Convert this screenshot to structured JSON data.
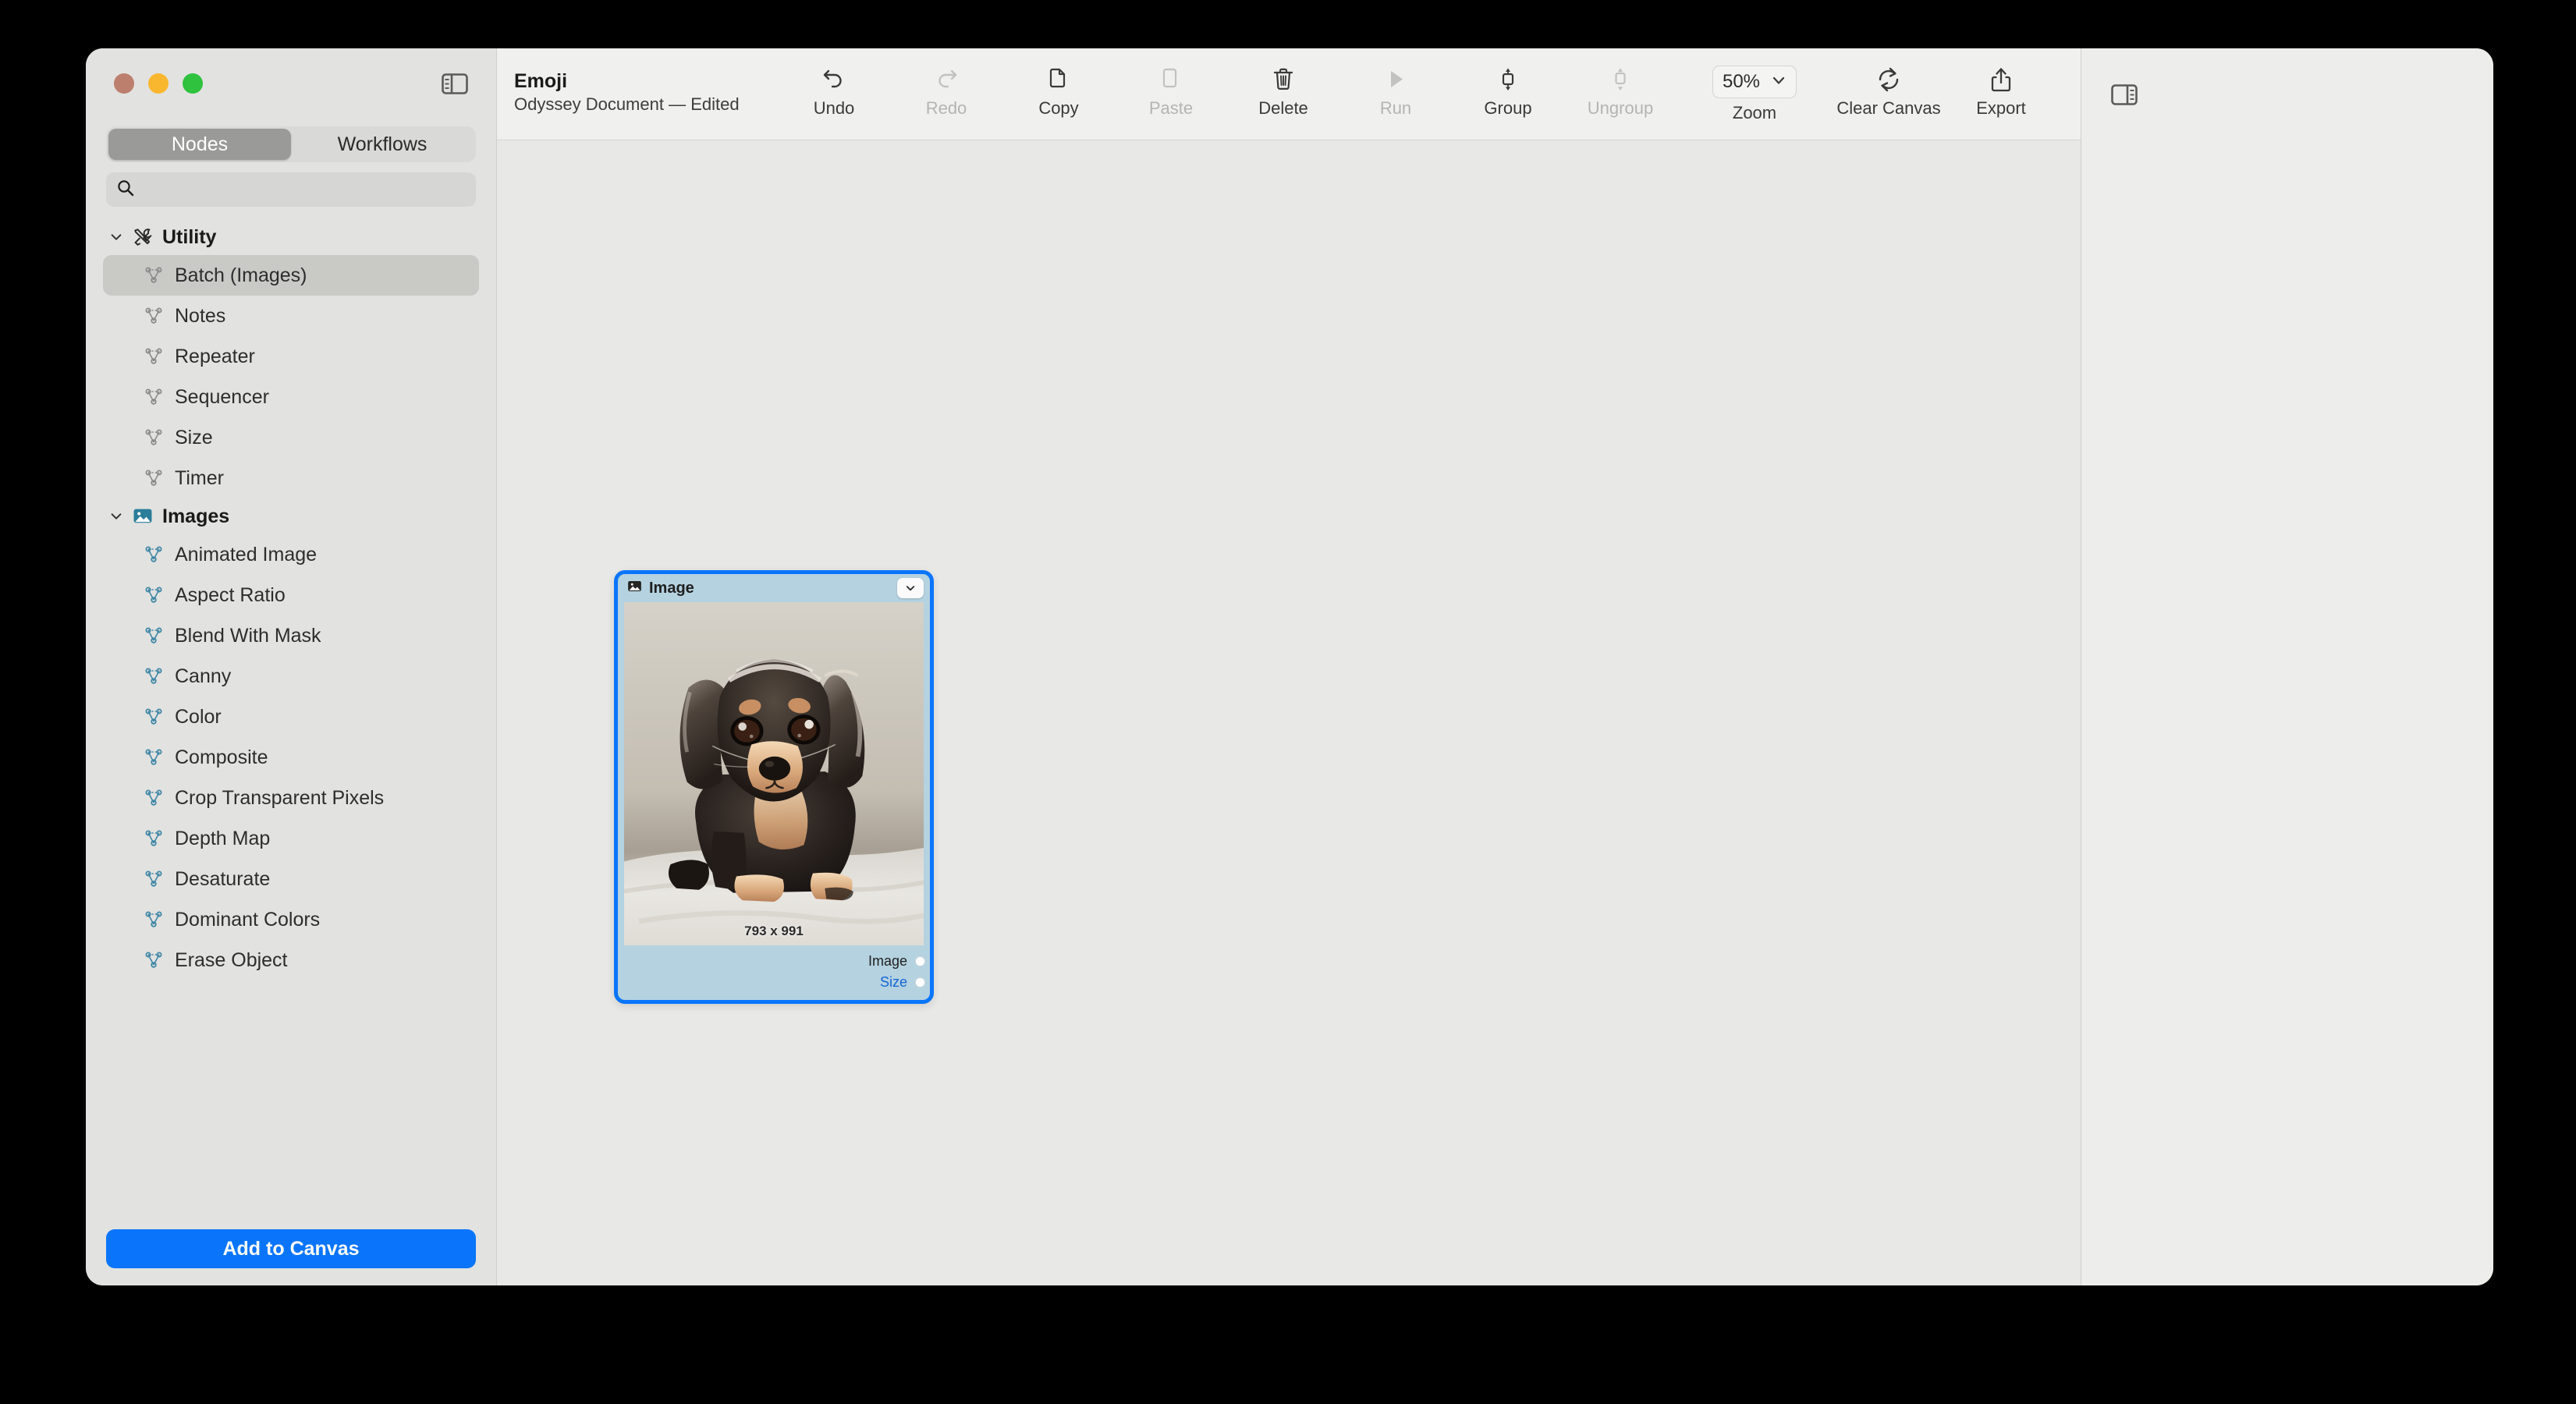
{
  "window": {
    "traffic_lights": [
      "close",
      "minimize",
      "zoom"
    ],
    "colors": {
      "close": "#bd7f6d",
      "minimize": "#f9b72f",
      "zoom": "#2ec23e",
      "accent": "#0a75fb",
      "node_border": "#0a75fb",
      "node_header": "#b4d2e0",
      "canvas_bg": "#e8e8e6",
      "sidebar_bg": "#e2e2e0",
      "toolbar_bg": "#f0f0ee"
    }
  },
  "sidebar": {
    "toggle_icon": "sidebar-left-icon",
    "segmented": {
      "options": [
        "Nodes",
        "Workflows"
      ],
      "selected": "Nodes"
    },
    "search": {
      "placeholder": "",
      "value": "",
      "icon": "search-icon"
    },
    "groups": [
      {
        "label": "Utility",
        "icon": "tools-icon",
        "expanded": true,
        "items": [
          {
            "label": "Batch (Images)",
            "icon": "node-graph-icon",
            "selected": true
          },
          {
            "label": "Notes",
            "icon": "node-graph-icon",
            "selected": false
          },
          {
            "label": "Repeater",
            "icon": "node-graph-icon",
            "selected": false
          },
          {
            "label": "Sequencer",
            "icon": "node-graph-icon",
            "selected": false
          },
          {
            "label": "Size",
            "icon": "node-graph-icon",
            "selected": false
          },
          {
            "label": "Timer",
            "icon": "node-graph-icon",
            "selected": false
          }
        ]
      },
      {
        "label": "Images",
        "icon": "photo-icon",
        "expanded": true,
        "items": [
          {
            "label": "Animated Image",
            "icon": "node-graph-icon",
            "selected": false
          },
          {
            "label": "Aspect Ratio",
            "icon": "node-graph-icon",
            "selected": false
          },
          {
            "label": "Blend With Mask",
            "icon": "node-graph-icon",
            "selected": false
          },
          {
            "label": "Canny",
            "icon": "node-graph-icon",
            "selected": false
          },
          {
            "label": "Color",
            "icon": "node-graph-icon",
            "selected": false
          },
          {
            "label": "Composite",
            "icon": "node-graph-icon",
            "selected": false
          },
          {
            "label": "Crop Transparent Pixels",
            "icon": "node-graph-icon",
            "selected": false
          },
          {
            "label": "Depth Map",
            "icon": "node-graph-icon",
            "selected": false
          },
          {
            "label": "Desaturate",
            "icon": "node-graph-icon",
            "selected": false
          },
          {
            "label": "Dominant Colors",
            "icon": "node-graph-icon",
            "selected": false
          },
          {
            "label": "Erase Object",
            "icon": "node-graph-icon",
            "selected": false
          }
        ]
      }
    ],
    "add_button": "Add to Canvas"
  },
  "toolbar": {
    "document_title": "Emoji",
    "document_subtitle": "Odyssey Document — Edited",
    "items": [
      {
        "label": "Undo",
        "icon": "undo-icon",
        "disabled": false
      },
      {
        "label": "Redo",
        "icon": "redo-icon",
        "disabled": true
      },
      {
        "label": "Copy",
        "icon": "copy-icon",
        "disabled": false
      },
      {
        "label": "Paste",
        "icon": "paste-icon",
        "disabled": true
      },
      {
        "label": "Delete",
        "icon": "trash-icon",
        "disabled": false
      },
      {
        "label": "Run",
        "icon": "play-icon",
        "disabled": true
      },
      {
        "label": "Group",
        "icon": "group-icon",
        "disabled": false
      },
      {
        "label": "Ungroup",
        "icon": "ungroup-icon",
        "disabled": true
      }
    ],
    "zoom": {
      "label": "Zoom",
      "value": "50%",
      "chevron": "chevron-down-icon"
    },
    "clear_canvas": {
      "label": "Clear Canvas",
      "icon": "refresh-icon"
    },
    "export": {
      "label": "Export",
      "icon": "share-icon"
    }
  },
  "canvas": {
    "node": {
      "title": "Image",
      "title_icon": "photo-icon",
      "collapse_icon": "chevron-down-icon",
      "dimensions": "793 x 991",
      "outputs": [
        {
          "label": "Image",
          "highlighted": false
        },
        {
          "label": "Size",
          "highlighted": true
        }
      ],
      "selected": true
    }
  },
  "inspector": {
    "toggle_icon": "sidebar-right-icon"
  }
}
